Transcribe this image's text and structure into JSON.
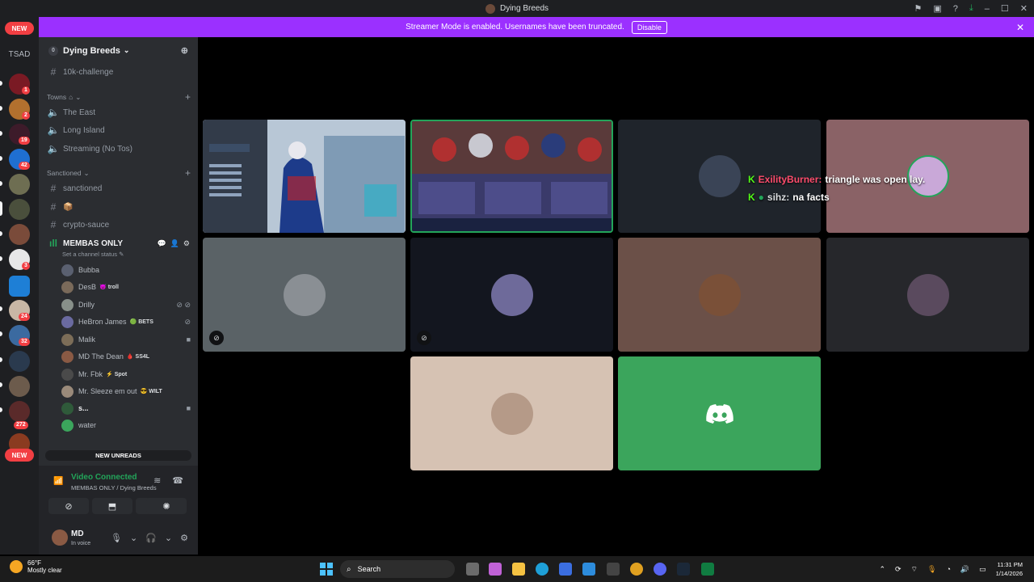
{
  "window": {
    "title": "Dying Breeds"
  },
  "banner": {
    "text": "Streamer Mode is enabled. Usernames have been truncated.",
    "disable_label": "Disable"
  },
  "rail": {
    "tsad_label": "TSAD",
    "new_top": "NEW",
    "new_bottom": "NEW",
    "badges": [
      "1",
      "2",
      "19",
      "42",
      "3",
      "24",
      "32",
      "272"
    ]
  },
  "sidebar": {
    "guild_name": "Dying Breeds",
    "channels_top": [
      {
        "label": "10k-challenge"
      }
    ],
    "towns_category": "Towns",
    "towns": [
      {
        "label": "The East"
      },
      {
        "label": "Long Island"
      },
      {
        "label": "Streaming (No Tos)"
      }
    ],
    "sanctioned_category": "Sanctioned",
    "sanctioned": [
      {
        "label": "sanctioned"
      },
      {
        "label": "📦"
      },
      {
        "label": "crypto-sauce"
      }
    ],
    "voice_channel": "MEMBAS ONLY",
    "channel_status_placeholder": "Set a channel status",
    "members": [
      {
        "name": "Bubba",
        "tag": ""
      },
      {
        "name": "DesB",
        "tag": "troll"
      },
      {
        "name": "Drilly",
        "tag": ""
      },
      {
        "name": "HeBron James",
        "tag": "BETS"
      },
      {
        "name": "Malik",
        "tag": ""
      },
      {
        "name": "MD The Dean",
        "tag": "SS4L"
      },
      {
        "name": "Mr. Fbk",
        "tag": "Spot"
      },
      {
        "name": "Mr. Sleeze em out",
        "tag": "WILT"
      },
      {
        "name": "s...",
        "tag": ""
      },
      {
        "name": "water",
        "tag": ""
      }
    ],
    "new_unreads": "NEW UNREADS"
  },
  "voice_panel": {
    "status": "Video Connected",
    "location": "MEMBAS ONLY / Dying Breeds",
    "user_name": "MD",
    "user_status": "In voice"
  },
  "chat_overlay": {
    "line1_user": "ExilityBurner:",
    "line1_text": "triangle was open lay.",
    "line2_user": "sihz:",
    "line2_text": "na facts"
  },
  "taskbar": {
    "temperature": "66°F",
    "weather": "Mostly clear",
    "search_placeholder": "Search",
    "time": "11:31 PM",
    "date": "1/14/2026"
  },
  "colors": {
    "banner": "#9b30ff",
    "connected": "#23a55a",
    "discord_tile": "#3ba55c",
    "notification": "#f23f43"
  }
}
